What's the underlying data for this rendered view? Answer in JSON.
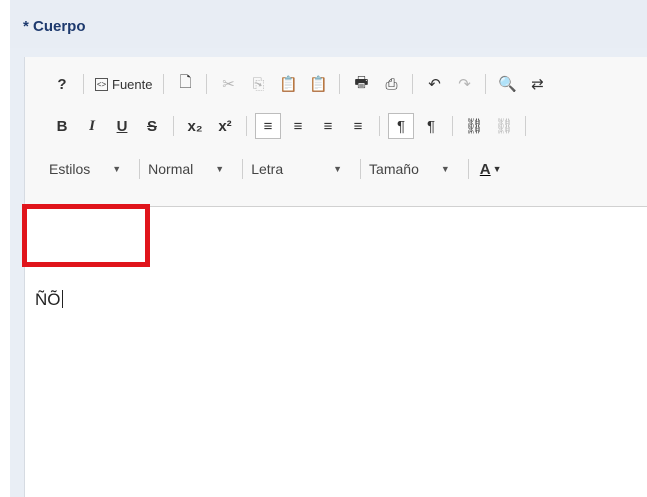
{
  "field": {
    "label": "* Cuerpo"
  },
  "toolbar": {
    "row1": {
      "help": "?",
      "source_label": "Fuente",
      "new_page": "🗋",
      "cut": "✂",
      "copy": "⎘",
      "paste": "📋",
      "paste_text": "📋",
      "paste_word": "📋",
      "print": "🖶",
      "templates": "⎙",
      "undo": "↶",
      "redo": "↷",
      "find": "🔍",
      "replace": "⇄"
    },
    "row2": {
      "bold": "B",
      "italic": "I",
      "underline": "U",
      "strike": "S",
      "subscript": "x₂",
      "superscript": "x²",
      "align_left": "≡",
      "align_center": "≡",
      "align_right": "≡",
      "justify": "≡",
      "ltr": "¶",
      "rtl": "¶",
      "link": "⛓",
      "unlink": "⛓"
    },
    "row3": {
      "styles": "Estilos",
      "format": "Normal",
      "font": "Letra",
      "size": "Tamaño",
      "text_color": "A"
    }
  },
  "editor": {
    "content": "ÑÕ"
  },
  "colors": {
    "highlight": "#e0141b",
    "label": "#1e3a6e"
  }
}
